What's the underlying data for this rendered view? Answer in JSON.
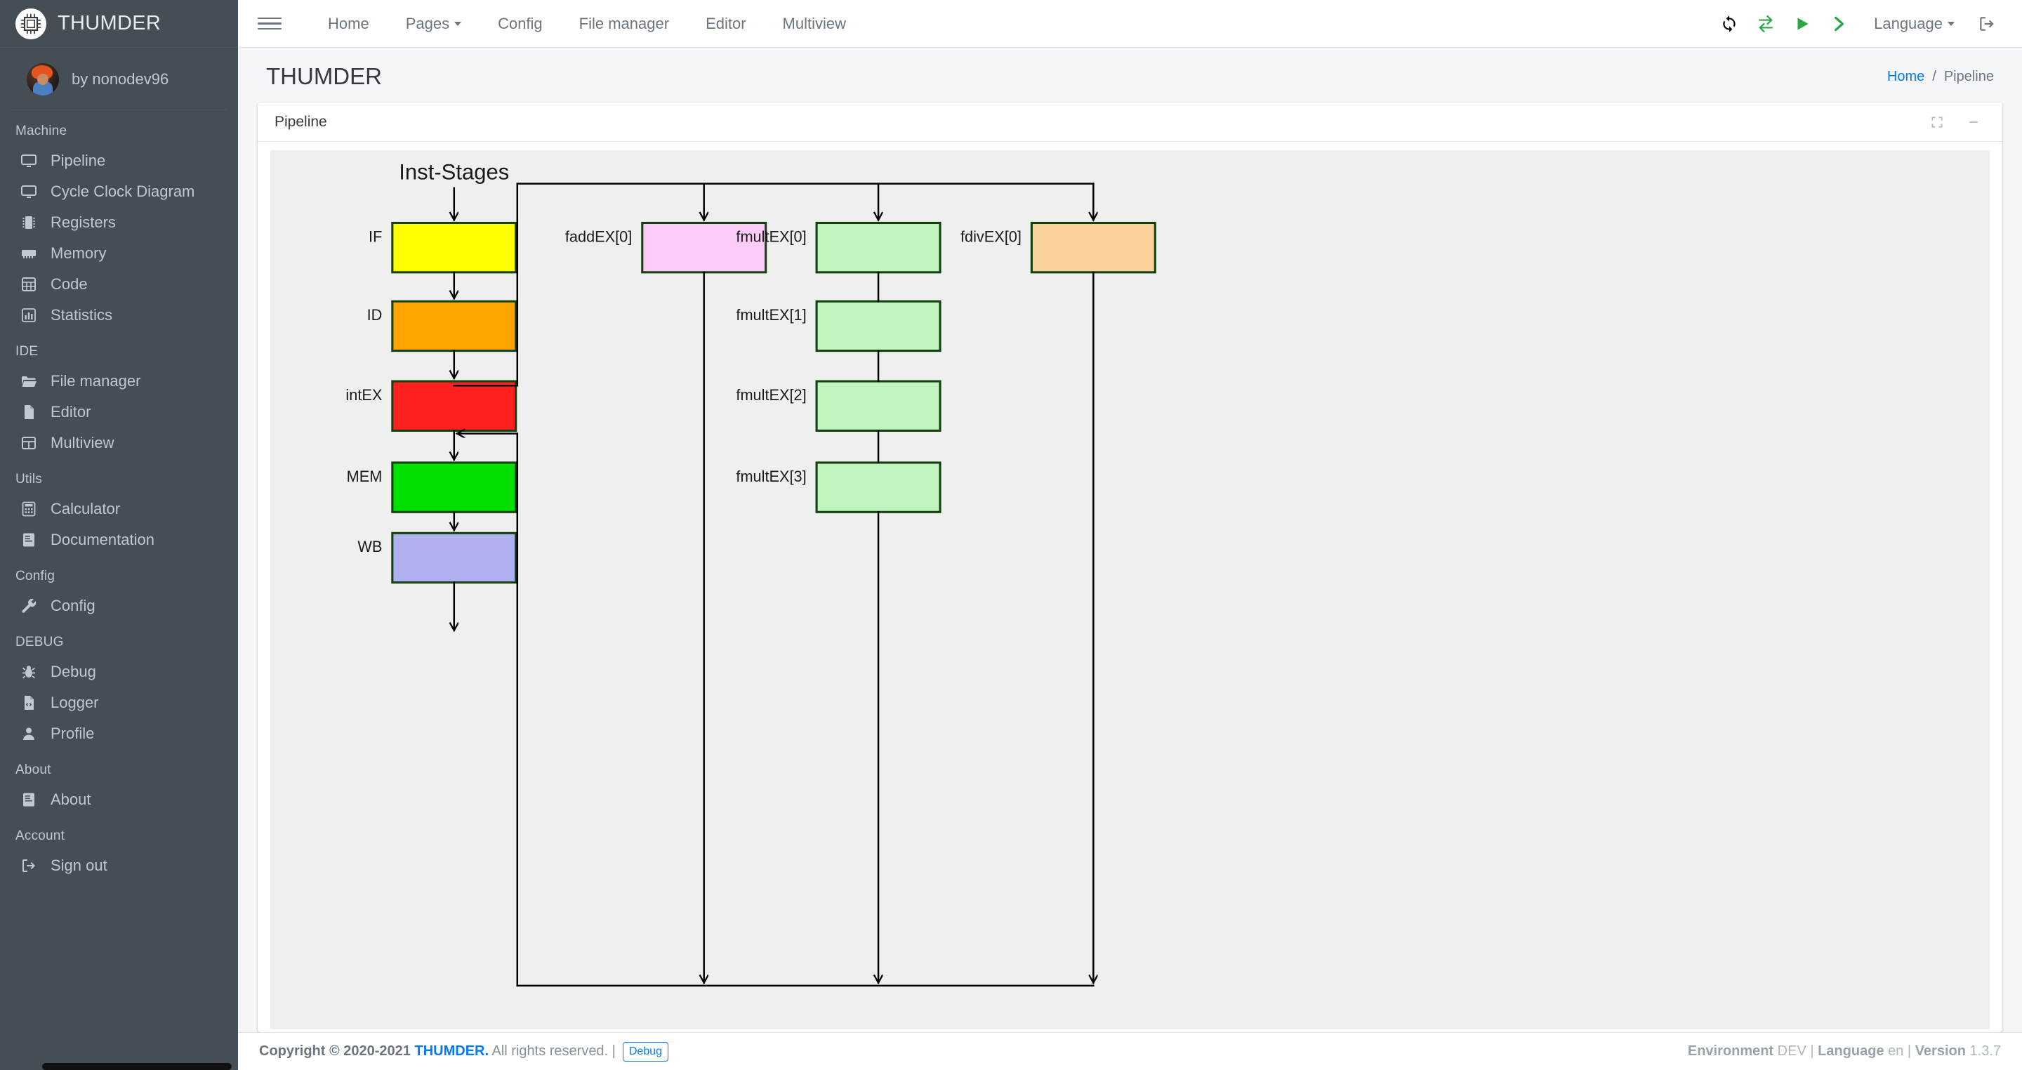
{
  "sidebar": {
    "brand": {
      "title": "THUMDER",
      "logo_icon": "cpu-chip-icon"
    },
    "user": {
      "name": "by nonodev96",
      "avatar_icon": "avatar"
    },
    "groups": [
      {
        "title": "Machine",
        "items": [
          {
            "label": "Pipeline",
            "icon": "desktop-icon"
          },
          {
            "label": "Cycle Clock Diagram",
            "icon": "desktop-icon"
          },
          {
            "label": "Registers",
            "icon": "memory-chip-icon"
          },
          {
            "label": "Memory",
            "icon": "memory-bank-icon"
          },
          {
            "label": "Code",
            "icon": "grid-table-icon"
          },
          {
            "label": "Statistics",
            "icon": "bar-chart-icon"
          }
        ]
      },
      {
        "title": "IDE",
        "items": [
          {
            "label": "File manager",
            "icon": "folder-open-icon"
          },
          {
            "label": "Editor",
            "icon": "file-icon"
          },
          {
            "label": "Multiview",
            "icon": "table-icon"
          }
        ]
      },
      {
        "title": "Utils",
        "items": [
          {
            "label": "Calculator",
            "icon": "calculator-icon"
          },
          {
            "label": "Documentation",
            "icon": "book-icon"
          }
        ]
      },
      {
        "title": "Config",
        "items": [
          {
            "label": "Config",
            "icon": "wrench-icon"
          }
        ]
      },
      {
        "title": "DEBUG",
        "items": [
          {
            "label": "Debug",
            "icon": "bug-icon"
          },
          {
            "label": "Logger",
            "icon": "file-code-icon"
          },
          {
            "label": "Profile",
            "icon": "user-icon"
          }
        ]
      },
      {
        "title": "About",
        "items": [
          {
            "label": "About",
            "icon": "book-icon"
          }
        ]
      },
      {
        "title": "Account",
        "items": [
          {
            "label": "Sign out",
            "icon": "sign-out-icon"
          }
        ]
      }
    ]
  },
  "topnav": {
    "menu_icon": "hamburger-icon",
    "links": [
      {
        "label": "Home",
        "dropdown": false
      },
      {
        "label": "Pages",
        "dropdown": true
      },
      {
        "label": "Config",
        "dropdown": false
      },
      {
        "label": "File manager",
        "dropdown": false
      },
      {
        "label": "Editor",
        "dropdown": false
      },
      {
        "label": "Multiview",
        "dropdown": false
      }
    ],
    "actions": [
      {
        "name": "sync-icon",
        "color": "#000000"
      },
      {
        "name": "exchange-icon",
        "color": "#28a745"
      },
      {
        "name": "play-icon",
        "color": "#28a745"
      },
      {
        "name": "step-forward-icon",
        "color": "#28a745"
      }
    ],
    "language_label": "Language",
    "signout_icon": "sign-out-icon"
  },
  "content": {
    "page_title": "THUMDER",
    "breadcrumb": {
      "home": "Home",
      "separator": "/",
      "current": "Pipeline"
    }
  },
  "card": {
    "title": "Pipeline",
    "expand_icon": "expand-icon",
    "collapse_icon": "minimize-icon"
  },
  "diagram": {
    "title": "Inst-Stages",
    "colors": {
      "border": "#14420f",
      "background": "#efefef",
      "line": "#000000"
    },
    "stages": [
      {
        "label": "IF",
        "color": "#ffff00"
      },
      {
        "label": "ID",
        "color": "#ffa500"
      },
      {
        "label": "intEX",
        "color": "#ff2020"
      },
      {
        "label": "MEM",
        "color": "#00e000"
      },
      {
        "label": "WB",
        "color": "#b0b0f0"
      }
    ],
    "fp_units": [
      {
        "label": "faddEX[0]",
        "color": "#ffccf9"
      },
      {
        "label": "fmultEX[0]",
        "color": "#c0f5c0"
      },
      {
        "label": "fmultEX[1]",
        "color": "#c0f5c0"
      },
      {
        "label": "fmultEX[2]",
        "color": "#c0f5c0"
      },
      {
        "label": "fmultEX[3]",
        "color": "#c0f5c0"
      },
      {
        "label": "fdivEX[0]",
        "color": "#fbd39a"
      }
    ]
  },
  "footer": {
    "copyright_prefix": "Copyright © 2020-2021",
    "brand": "THUMDER.",
    "rights": "All rights reserved. |",
    "debug_label": "Debug",
    "env_label": "Environment",
    "env_value": "DEV |",
    "lang_label": "Language",
    "lang_value": "en |",
    "version_label": "Version",
    "version_value": "1.3.7"
  }
}
